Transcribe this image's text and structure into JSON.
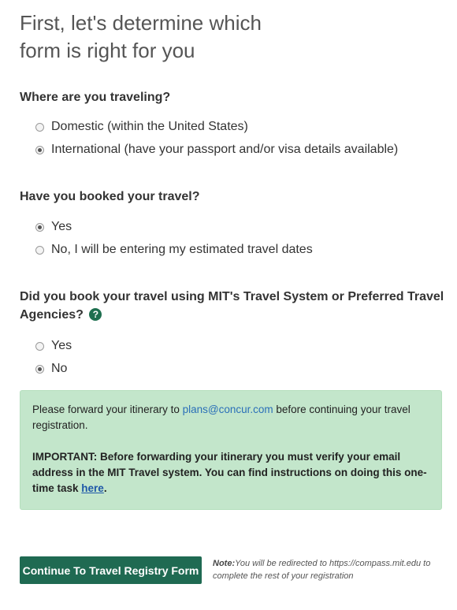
{
  "page": {
    "title": "First, let's determine which form is right for you"
  },
  "question1": {
    "label": "Where are you traveling?",
    "options": [
      {
        "label": "Domestic (within the United States)",
        "checked": false
      },
      {
        "label": "International (have your passport and/or visa details available)",
        "checked": true
      }
    ]
  },
  "question2": {
    "label": "Have you booked your travel?",
    "options": [
      {
        "label": "Yes",
        "checked": true
      },
      {
        "label": "No, I will be entering my estimated travel dates",
        "checked": false
      }
    ]
  },
  "question3": {
    "label": "Did you book your travel using MIT's Travel System or Preferred Travel Agencies?",
    "help_icon": "question-circle-icon",
    "help_glyph": "?",
    "options": [
      {
        "label": "Yes",
        "checked": false
      },
      {
        "label": "No",
        "checked": true
      }
    ]
  },
  "alert": {
    "line1_before": "Please forward your itinerary to ",
    "email": "plans@concur.com",
    "line1_after": " before continuing your travel registration.",
    "important_text": "IMPORTANT: Before forwarding your itinerary you must verify your email address in the MIT Travel system. You can find instructions on doing this one-time task ",
    "here_link": "here",
    "important_end": "."
  },
  "footer": {
    "button_label": "Continue To Travel Registry Form",
    "note_label": "Note:",
    "note_text": "You will be redirected to https://compass.mit.edu to complete the rest of your registration"
  },
  "colors": {
    "accent": "#1f6a52",
    "alert_bg": "#c3e6cb",
    "link": "#2a6fb8"
  }
}
